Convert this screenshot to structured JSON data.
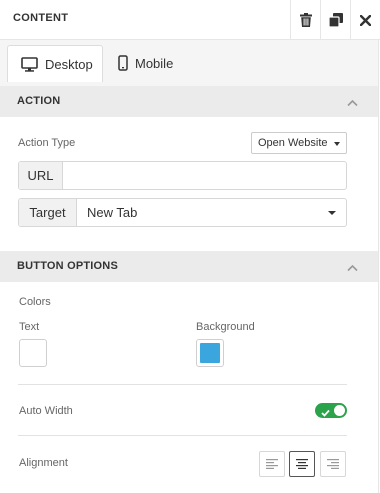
{
  "header": {
    "title": "CONTENT"
  },
  "tabs": [
    {
      "label": "Desktop",
      "icon": "desktop-icon",
      "active": true
    },
    {
      "label": "Mobile",
      "icon": "mobile-icon",
      "active": false
    }
  ],
  "action_section": {
    "title": "ACTION",
    "action_type_label": "Action Type",
    "action_type_value": "Open Website",
    "url": {
      "addon": "URL",
      "value": ""
    },
    "target": {
      "addon": "Target",
      "value": "New Tab"
    }
  },
  "button_options": {
    "title": "BUTTON OPTIONS",
    "colors_label": "Colors",
    "text_label": "Text",
    "background_label": "Background",
    "text_color": "#ffffff",
    "background_color": "#3ba6dd",
    "auto_width_label": "Auto Width",
    "auto_width_on": true,
    "toggle_color": "#2aa34a",
    "alignment_label": "Alignment",
    "alignment_selected": "center"
  }
}
